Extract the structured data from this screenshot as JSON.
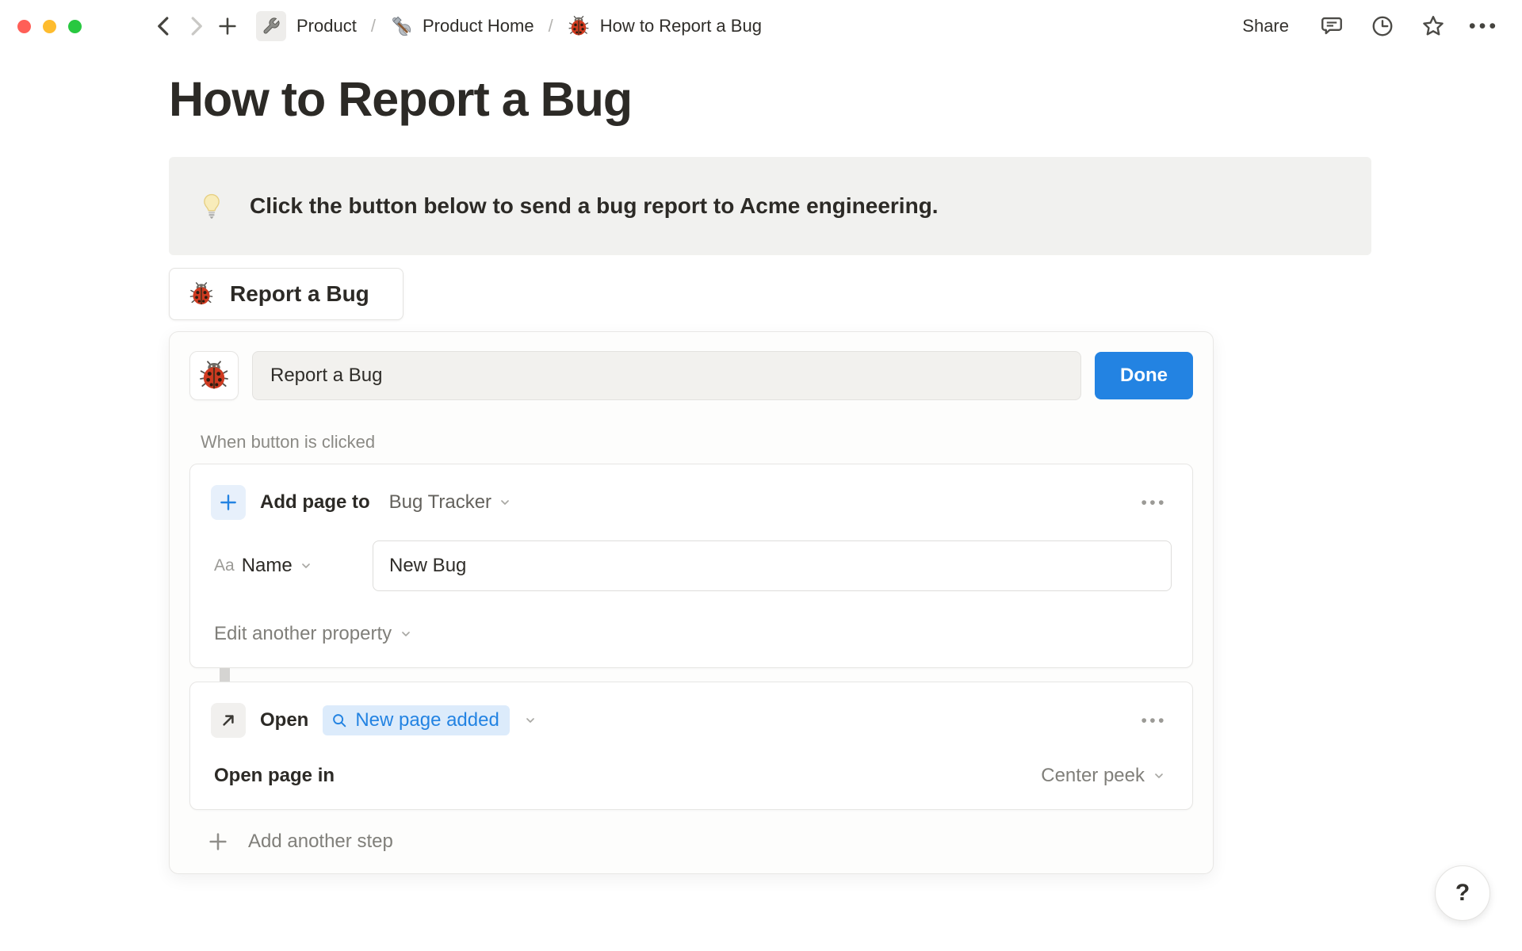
{
  "topbar": {
    "separator": "/",
    "breadcrumbs": [
      {
        "label": "Product"
      },
      {
        "label": "Product Home"
      },
      {
        "label": "How to Report a Bug"
      }
    ],
    "share_label": "Share"
  },
  "page": {
    "title": "How to Report a Bug",
    "callout": {
      "text": "Click the button below to send a bug report to Acme engineering."
    },
    "button_block_label": "Report a Bug"
  },
  "editor": {
    "name_value": "Report a Bug",
    "done_label": "Done",
    "trigger_label": "When button is clicked",
    "step1": {
      "action_label": "Add page to",
      "target_label": "Bug Tracker",
      "property_type_glyph": "Aa",
      "property_name": "Name",
      "property_value": "New Bug",
      "edit_another_label": "Edit another property"
    },
    "step2": {
      "action_label": "Open",
      "pill_label": "New page added",
      "open_in_label": "Open page in",
      "open_in_value": "Center peek"
    },
    "add_step_label": "Add another step"
  },
  "glyphs": {
    "more": "•••"
  },
  "help": {
    "label": "?"
  },
  "colors": {
    "accent_blue": "#2383e2",
    "pill_bg": "#dcebfb",
    "callout_bg": "#f1f1ef",
    "text_dark": "#2c2a26",
    "text_gray": "#807f7a",
    "traffic_red": "#ff5f57",
    "traffic_yellow": "#febc2e",
    "traffic_green": "#28c840"
  }
}
